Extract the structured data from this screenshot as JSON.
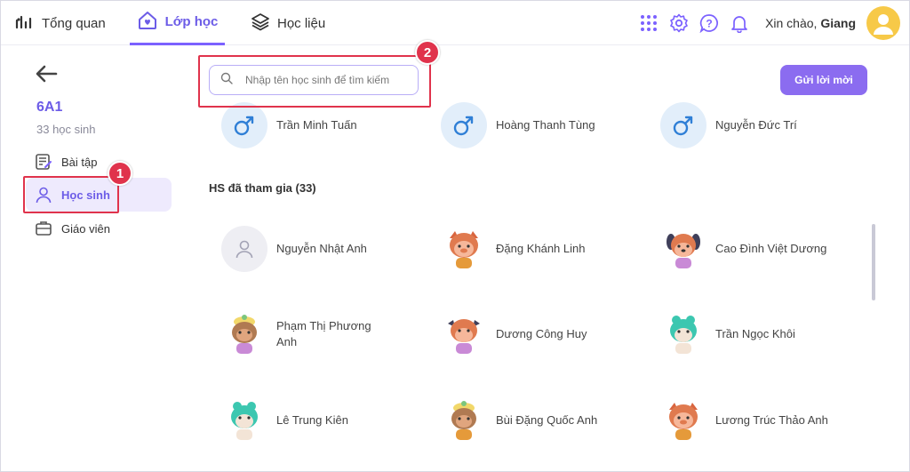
{
  "topbar": {
    "nav": [
      {
        "label": "Tổng quan",
        "icon": "chart-icon"
      },
      {
        "label": "Lớp học",
        "icon": "heart-house-icon"
      },
      {
        "label": "Học liệu",
        "icon": "layers-icon"
      }
    ],
    "greeting_prefix": "Xin chào,",
    "user_name": "Giang"
  },
  "sidebar": {
    "class_name": "6A1",
    "class_count": "33 học sinh",
    "items": [
      {
        "label": "Bài tập",
        "icon": "assignment-icon"
      },
      {
        "label": "Học sinh",
        "icon": "user-icon"
      },
      {
        "label": "Giáo viên",
        "icon": "briefcase-icon"
      }
    ]
  },
  "main": {
    "search_placeholder": "Nhập tên học sinh để tìm kiếm",
    "invite_label": "Gửi lời mời",
    "top_students": [
      {
        "name": "Trần Minh Tuấn"
      },
      {
        "name": "Hoàng Thanh Tùng"
      },
      {
        "name": "Nguyễn Đức Trí"
      }
    ],
    "section_title": "HS đã tham gia (33)",
    "students": [
      {
        "name": "Nguyễn Nhật Anh",
        "avatar": "default"
      },
      {
        "name": "Đặng Khánh Linh",
        "avatar": "pig"
      },
      {
        "name": "Cao Đình Việt Dương",
        "avatar": "dog"
      },
      {
        "name": "Phạm Thị Phương Anh",
        "avatar": "bird"
      },
      {
        "name": "Dương Công Huy",
        "avatar": "bull"
      },
      {
        "name": "Trần Ngọc Khôi",
        "avatar": "frog"
      },
      {
        "name": "Lê Trung Kiên",
        "avatar": "frog"
      },
      {
        "name": "Bùi Đặng Quốc Anh",
        "avatar": "bird"
      },
      {
        "name": "Lương Trúc Thảo Anh",
        "avatar": "pig"
      }
    ]
  },
  "annotations": {
    "badge1": "1",
    "badge2": "2"
  },
  "colors": {
    "accent": "#6c5ce7",
    "button": "#8b6cf0",
    "callout": "#e0334c"
  }
}
